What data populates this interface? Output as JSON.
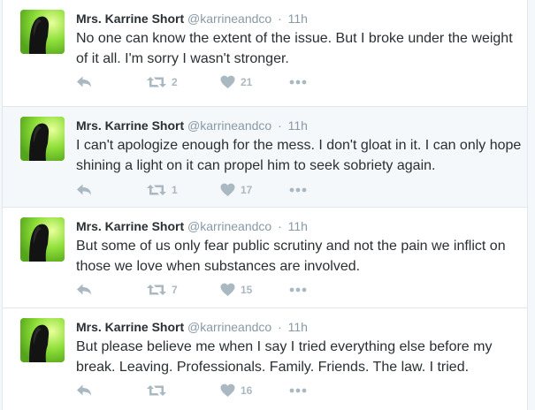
{
  "tweets": [
    {
      "name": "Mrs. Karrine Short",
      "handle": "@karrineandco",
      "separator": "·",
      "time": "11h",
      "text": "No one can know the extent of the issue. But I broke under the weight of it all. I'm sorry I wasn't stronger.",
      "retweets": "2",
      "likes": "21"
    },
    {
      "name": "Mrs. Karrine Short",
      "handle": "@karrineandco",
      "separator": "·",
      "time": "11h",
      "text": "I can't apologize enough for the mess. I don't gloat in it. I can only hope shining a light on it can propel him to seek sobriety again.",
      "retweets": "1",
      "likes": "17"
    },
    {
      "name": "Mrs. Karrine Short",
      "handle": "@karrineandco",
      "separator": "·",
      "time": "11h",
      "text": "But some of us only fear public scrutiny and not the pain we inflict on those we love when substances are involved.",
      "retweets": "7",
      "likes": "15"
    },
    {
      "name": "Mrs. Karrine Short",
      "handle": "@karrineandco",
      "separator": "·",
      "time": "11h",
      "text": "But please believe me when I say I tried everything else before my break. Leaving. Professionals. Family. Friends. The law. I tried.",
      "retweets": "",
      "likes": "16"
    }
  ],
  "icons": {
    "reply": "reply-icon",
    "retweet": "retweet-icon",
    "like": "heart-icon",
    "more": "more-dots-icon"
  },
  "colors": {
    "name": "#292f33",
    "meta": "#8899a6",
    "action": "#aab8c2",
    "avatar_bg": "#7bd12f",
    "highlight_bg": "#f5f8fa"
  }
}
